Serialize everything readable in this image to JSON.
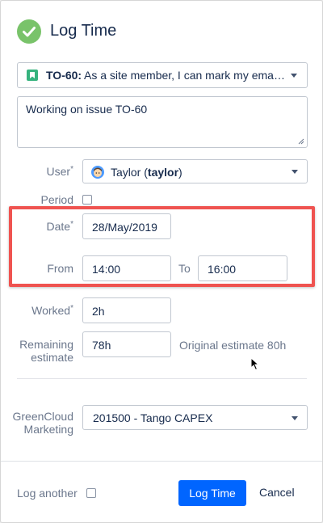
{
  "dialog": {
    "title": "Log Time",
    "header_icon": "check-circle-icon"
  },
  "issue": {
    "key": "TO-60:",
    "summary": "As a site member, I can mark my emails as read",
    "icon": "story-icon"
  },
  "description": {
    "value": "Working on issue TO-60"
  },
  "user": {
    "label": "User",
    "required_mark": "*",
    "name": "Taylor (",
    "username": "taylor",
    "close_paren": ")"
  },
  "period": {
    "label": "Period",
    "checked": false
  },
  "date": {
    "label": "Date",
    "required_mark": "*",
    "value": "28/May/2019"
  },
  "time_range": {
    "from_label": "From",
    "from_value": "14:00",
    "to_label": "To",
    "to_value": "16:00"
  },
  "worked": {
    "label": "Worked",
    "required_mark": "*",
    "value": "2h"
  },
  "remaining": {
    "label_line1": "Remaining",
    "label_line2": "estimate",
    "value": "78h",
    "original_estimate": "Original estimate 80h"
  },
  "account": {
    "label_line1": "GreenCloud",
    "label_line2": "Marketing",
    "value": "201500 - Tango CAPEX"
  },
  "footer": {
    "log_another_label": "Log another",
    "log_another_checked": false,
    "submit_label": "Log Time",
    "cancel_label": "Cancel"
  },
  "colors": {
    "primary": "#0065ff",
    "success": "#79c36a",
    "highlight": "#ef5350"
  }
}
